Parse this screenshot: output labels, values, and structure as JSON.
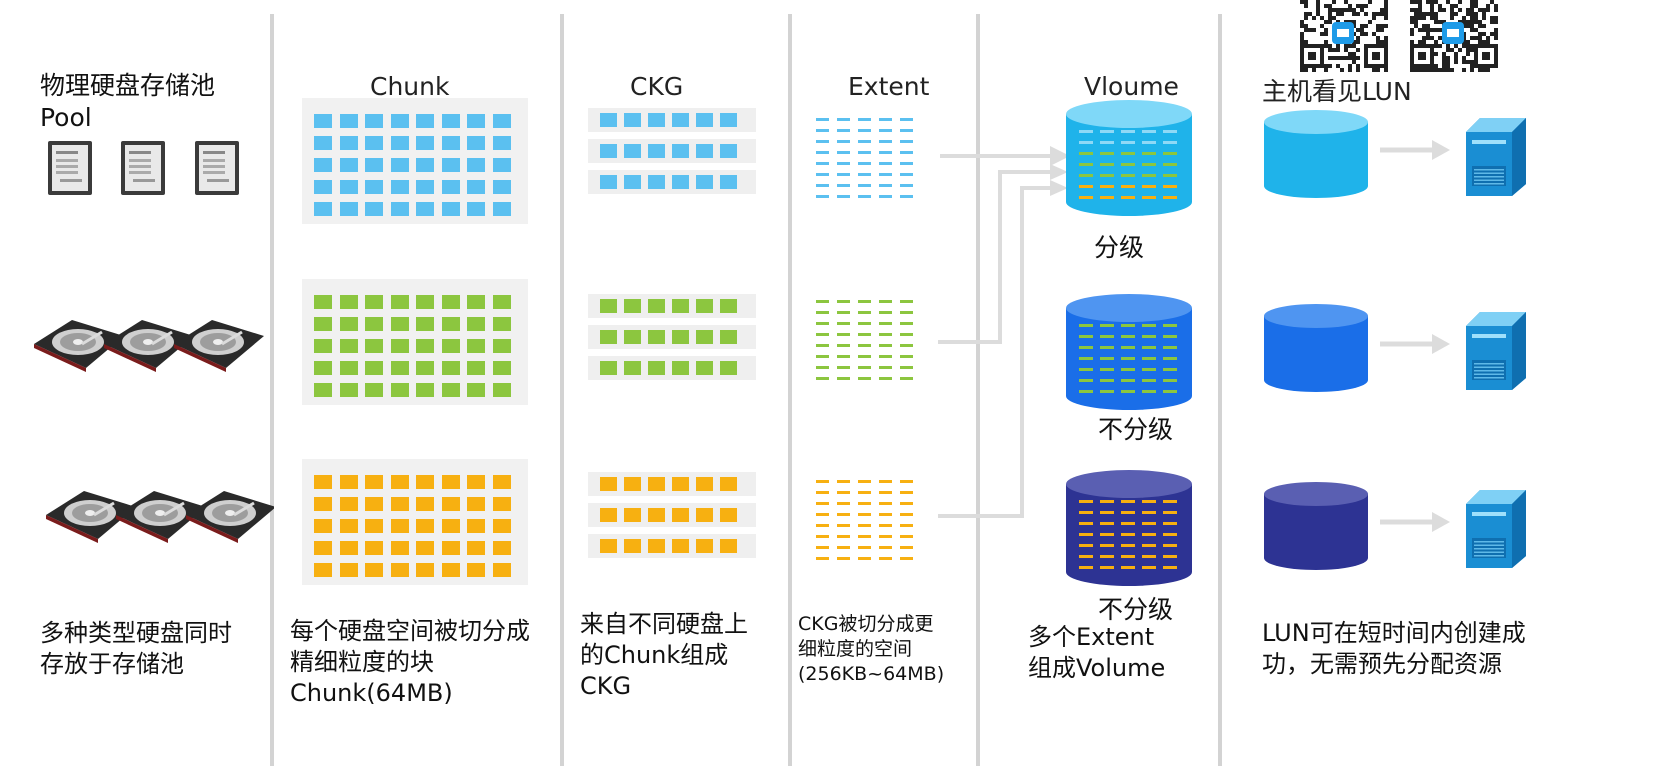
{
  "columns": {
    "pool": {
      "title_line1": "物理硬盘存储池",
      "title_line2": "Pool",
      "caption": [
        "多种类型硬盘同时",
        "存放于存储池"
      ]
    },
    "chunk": {
      "title": "Chunk",
      "caption": [
        "每个硬盘空间被切分成",
        "精细粒度的块",
        "Chunk(64MB)"
      ]
    },
    "ckg": {
      "title": "CKG",
      "caption": [
        "来自不同硬盘上",
        "的Chunk组成",
        "CKG"
      ]
    },
    "extent": {
      "title": "Extent",
      "caption": [
        "CKG被切分成更",
        "细粒度的空间",
        "(256KB~64MB)"
      ]
    },
    "volume": {
      "title": "Vloume",
      "labels": [
        "分级",
        "不分级",
        "不分级"
      ],
      "caption": [
        "多个Extent",
        "组成Volume"
      ]
    },
    "lun": {
      "title": "主机看见LUN",
      "caption": [
        "LUN可在短时间内创建成",
        "功，无需预先分配资源"
      ]
    }
  },
  "colors": {
    "tier1": "#5bc0f0",
    "tier2": "#8cc63f",
    "tier3": "#f7b011",
    "volume_tiered": "#1fb3ea",
    "volume_blue": "#1a6ee8",
    "volume_navy": "#2d3393",
    "divider": "#d3d3d3",
    "arrow": "#dcdcdc"
  },
  "icons": [
    "ssd-icon",
    "hdd-icon",
    "database-cylinder-icon",
    "server-icon",
    "qr-code-icon"
  ]
}
